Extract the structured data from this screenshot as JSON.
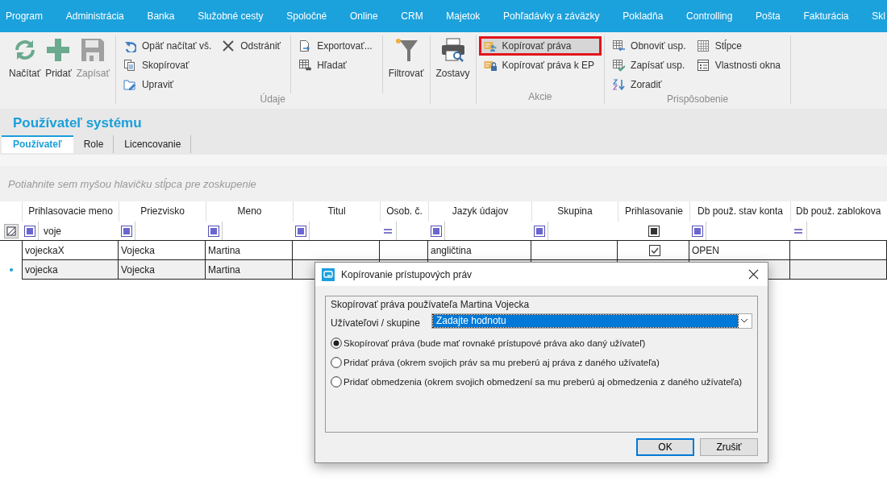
{
  "menu": [
    {
      "label": "Program"
    },
    {
      "label": "Administrácia"
    },
    {
      "label": "Banka"
    },
    {
      "label": "Služobné cesty"
    },
    {
      "label": "Spoločné"
    },
    {
      "label": "Online"
    },
    {
      "label": "CRM"
    },
    {
      "label": "Majetok"
    },
    {
      "label": "Pohľadávky a záväzky"
    },
    {
      "label": "Pokladňa"
    },
    {
      "label": "Controlling"
    },
    {
      "label": "Pošta"
    },
    {
      "label": "Fakturácia"
    },
    {
      "label": "Skl"
    }
  ],
  "ribbon": {
    "groups": [
      {
        "sections": [
          [
            {
              "kind": "large",
              "items": [
                {
                  "label": "Načítať",
                  "disabled": false
                }
              ]
            },
            {
              "kind": "large",
              "items": [
                {
                  "label": "Pridať",
                  "disabled": false
                }
              ]
            },
            {
              "kind": "large",
              "items": [
                {
                  "label": "Zapísať",
                  "disabled": true
                }
              ]
            }
          ]
        ]
      },
      {
        "label": "Údaje",
        "sections": [
          [
            {
              "kind": "small",
              "items": [
                {
                  "label": "Opäť načítať vš."
                },
                {
                  "label": "Skopírovať"
                },
                {
                  "label": "Upraviť"
                }
              ]
            },
            {
              "kind": "small",
              "items": [
                {
                  "label": "Odstrániť"
                }
              ]
            }
          ],
          [
            {
              "kind": "small",
              "items": [
                {
                  "label": "Exportovať..."
                },
                {
                  "label": "Hľadať"
                }
              ]
            }
          ],
          [
            {
              "kind": "large",
              "items": [
                {
                  "label": "Filtrovať",
                  "disabled": false
                }
              ]
            }
          ]
        ]
      },
      {
        "sections": [
          [
            {
              "kind": "large",
              "items": [
                {
                  "label": "Zostavy",
                  "disabled": false
                }
              ]
            }
          ]
        ]
      },
      {
        "label": "Akcie",
        "sections": [
          [
            {
              "kind": "small",
              "items": [
                {
                  "label": "Kopírovať práva",
                  "highlighted": true
                },
                {
                  "label": "Kopírovať práva k EP",
                  "highlighted": false
                }
              ]
            }
          ]
        ]
      },
      {
        "label": "Prispôsobenie",
        "sections": [
          [
            {
              "kind": "small",
              "items": [
                {
                  "label": "Obnoviť usp."
                },
                {
                  "label": "Zapísať usp."
                },
                {
                  "label": "Zoradiť"
                }
              ]
            },
            {
              "kind": "small",
              "items": [
                {
                  "label": "Stĺpce"
                },
                {
                  "label": "Vlastnosti okna"
                }
              ]
            }
          ]
        ]
      }
    ]
  },
  "page": {
    "title": "Používateľ systému",
    "tabs": [
      {
        "label": "Používateľ",
        "selected": true
      },
      {
        "label": "Role",
        "selected": false
      },
      {
        "label": "Licencovanie",
        "selected": false
      }
    ]
  },
  "grid": {
    "group_hint": "Potiahnite sem myšou hlavičku stĺpca pre zoskupenie",
    "columns": [
      {
        "label": "Prihlasovacie meno",
        "kind": "contains",
        "filter_value": "voje"
      },
      {
        "label": "Priezvisko",
        "kind": "contains"
      },
      {
        "label": "Meno",
        "kind": "contains"
      },
      {
        "label": "Titul",
        "kind": "contains"
      },
      {
        "label": "Osob. č.",
        "kind": "equals"
      },
      {
        "label": "Jazyk údajov",
        "kind": "contains"
      },
      {
        "label": "Skupina",
        "kind": "contains"
      },
      {
        "label": "Prihlasovanie",
        "kind": "check",
        "filter_indeterminate": true
      },
      {
        "label": "Db použ. stav konta",
        "kind": "contains"
      },
      {
        "label": "Db použ. zablokova",
        "kind": "equals"
      }
    ],
    "rows": [
      {
        "selected": false,
        "cells": [
          "vojeckaX",
          "Vojecka",
          "Martina",
          null,
          null,
          "angličtina",
          null,
          true,
          "OPEN",
          null
        ]
      },
      {
        "selected": true,
        "cells": [
          "vojecka",
          "Vojecka",
          "Martina"
        ]
      }
    ]
  },
  "dialog": {
    "title": "Kopírovanie prístupových práv",
    "intro": "Skopírovať práva používateľa Martina Vojecka",
    "target_label": "Užívateľovi / skupine",
    "target_value": "Zadajte hodnotu",
    "options": [
      {
        "label": "Skopírovať práva (bude mať rovnaké prístupové práva ako daný užívateľ)",
        "selected": true
      },
      {
        "label": "Pridať práva (okrem svojich práv sa mu preberú aj práva z daného užívateľa)",
        "selected": false
      },
      {
        "label": "Pridať obmedzenia (okrem svojich obmedzení sa mu preberú aj obmedzenia z daného užívateľa)",
        "selected": false
      }
    ],
    "buttons": [
      "OK",
      "Zrušiť"
    ]
  }
}
